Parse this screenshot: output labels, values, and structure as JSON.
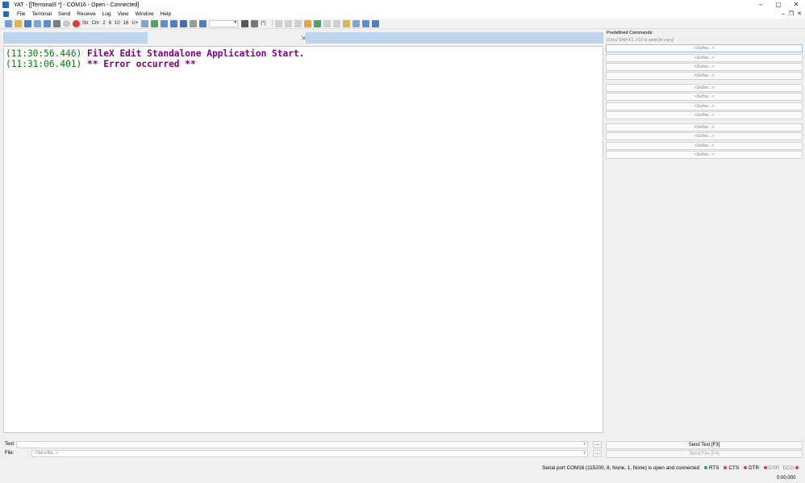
{
  "window": {
    "title": "YAT - [[Terminal3 *] - COM16 - Open - Connected]",
    "controls": [
      "–",
      "▢",
      "✕"
    ],
    "mdi_controls": [
      "–",
      "❐",
      "✕"
    ]
  },
  "menu": [
    "File",
    "Terminal",
    "Send",
    "Receive",
    "Log",
    "View",
    "Window",
    "Help"
  ],
  "toolbar": {
    "radix": [
      "Str",
      "Chr",
      "2",
      "8",
      "10",
      "16",
      "U+"
    ],
    "format": "(*)"
  },
  "monitor": {
    "lines": [
      {
        "timestamp": "(11:30:56.446)",
        "text": " FileX Edit Standalone Application Start."
      },
      {
        "timestamp": "(11:31:06.401)",
        "text": " ** Error occurred **"
      }
    ]
  },
  "predefined": {
    "title": "Predefined Commands:",
    "hint": "[Ctrl+] Shift+F1..F12 to send [to copy]",
    "buttons": [
      "<Define...>",
      "<Define...>",
      "<Define...>",
      "<Define...>",
      "<Define...>",
      "<Define...>",
      "<Define...>",
      "<Define...>",
      "<Define...>",
      "<Define...>",
      "<Define...>",
      "<Define...>"
    ]
  },
  "send": {
    "text_label": "Text:",
    "text_value": "",
    "file_label": "File:",
    "file_placeholder": "<Set a file...>",
    "browse": "...",
    "send_text": "Send Text [F3]",
    "send_file": "Send File [F4]"
  },
  "status": {
    "port": "Serial port COM16 (115200, 8, None, 1, None) is open and connected",
    "signals": [
      {
        "name": "RTS",
        "led": "#2fa84f",
        "active": true
      },
      {
        "name": "CTS",
        "led": "#e23c3c",
        "active": true
      },
      {
        "name": "DTR",
        "led": "#e23c3c",
        "active": true
      },
      {
        "name": "DSR",
        "led": "#e23c3c",
        "active": false
      },
      {
        "name": "DCD",
        "led": "#e23c3c",
        "active": false
      }
    ],
    "timer": "0:00.000"
  }
}
